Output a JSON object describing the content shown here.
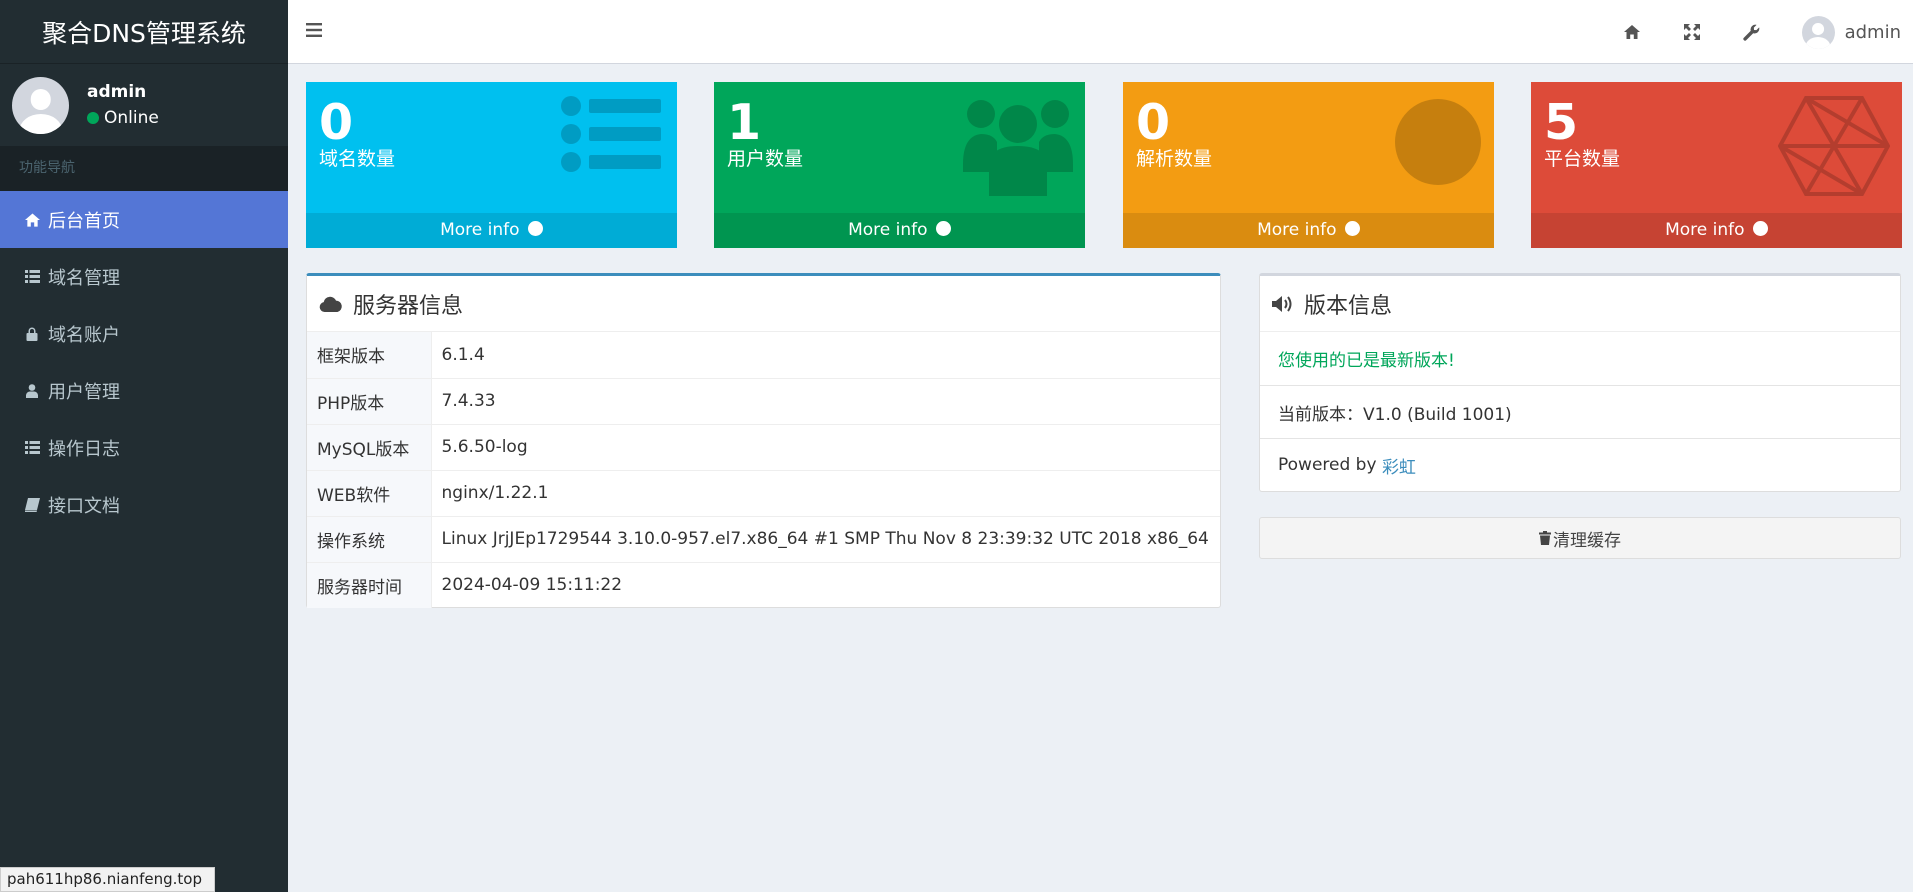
{
  "sidebar": {
    "logo": "聚合DNS管理系统",
    "user": {
      "name": "admin",
      "status": "Online"
    },
    "nav_header": "功能导航",
    "items": [
      {
        "label": "后台首页",
        "icon": "home-icon",
        "active": true
      },
      {
        "label": "域名管理",
        "icon": "list-icon"
      },
      {
        "label": "域名账户",
        "icon": "lock-icon"
      },
      {
        "label": "用户管理",
        "icon": "user-icon"
      },
      {
        "label": "操作日志",
        "icon": "list-icon"
      },
      {
        "label": "接口文档",
        "icon": "book-icon"
      }
    ]
  },
  "header": {
    "username": "admin",
    "icons": [
      "menu-icon",
      "home-icon",
      "fullscreen-icon",
      "wrench-icon"
    ]
  },
  "stats": [
    {
      "number": "0",
      "label": "域名数量",
      "more": "More info",
      "color": "#00c0ef",
      "icon": "list-icon"
    },
    {
      "number": "1",
      "label": "用户数量",
      "more": "More info",
      "color": "#00a65a",
      "icon": "users-icon"
    },
    {
      "number": "0",
      "label": "解析数量",
      "more": "More info",
      "color": "#f39c12",
      "icon": "globe-icon"
    },
    {
      "number": "5",
      "label": "平台数量",
      "more": "More info",
      "color": "#dd4b39",
      "icon": "network-icon"
    }
  ],
  "server_info": {
    "title": "服务器信息",
    "rows": [
      {
        "key": "框架版本",
        "value": "6.1.4"
      },
      {
        "key": "PHP版本",
        "value": "7.4.33"
      },
      {
        "key": "MySQL版本",
        "value": "5.6.50-log"
      },
      {
        "key": "WEB软件",
        "value": "nginx/1.22.1"
      },
      {
        "key": "操作系统",
        "value": "Linux JrjJEp1729544 3.10.0-957.el7.x86_64 #1 SMP Thu Nov 8 23:39:32 UTC 2018 x86_64"
      },
      {
        "key": "服务器时间",
        "value": "2024-04-09 15:11:22"
      }
    ]
  },
  "version_info": {
    "title": "版本信息",
    "latest_msg": "您使用的已是最新版本!",
    "current_version": "当前版本：V1.0 (Build 1001)",
    "powered_by": "Powered by",
    "powered_link": "彩虹",
    "latest_color": "#00a65a"
  },
  "clear_cache": "清理缓存",
  "status_url": "pah611hp86.nianfeng.top"
}
